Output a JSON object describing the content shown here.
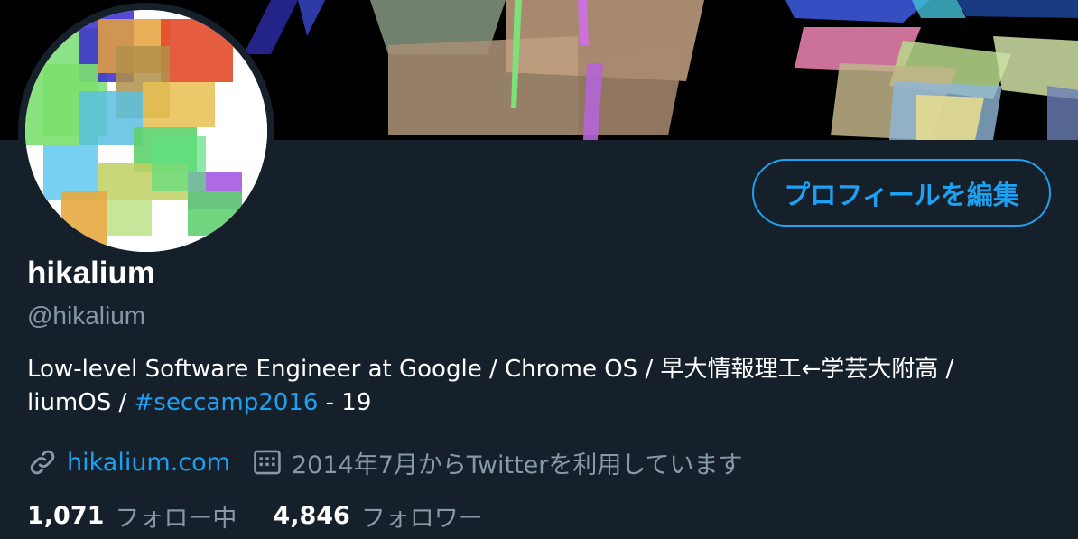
{
  "profile": {
    "display_name": "hikalium",
    "handle": "@hikalium",
    "edit_button_label": "プロフィールを編集",
    "bio": {
      "line1": "Low-level Software Engineer at Google / Chrome OS / 早大情報理工←学芸大附高 /",
      "line2_prefix": "liumOS / ",
      "hashtag": "#seccamp2016",
      "line2_suffix": " - 19"
    },
    "website": "hikalium.com",
    "joined": "2014年7月からTwitterを利用しています",
    "following_count": "1,071",
    "following_label": "フォロー中",
    "followers_count": "4,846",
    "followers_label": "フォロワー"
  },
  "icons": {
    "website": "link-icon",
    "joined": "calendar-icon"
  },
  "colors": {
    "background": "#15202b",
    "accent": "#1da1f2",
    "secondary_text": "#8899a6",
    "primary_text": "#ffffff"
  }
}
